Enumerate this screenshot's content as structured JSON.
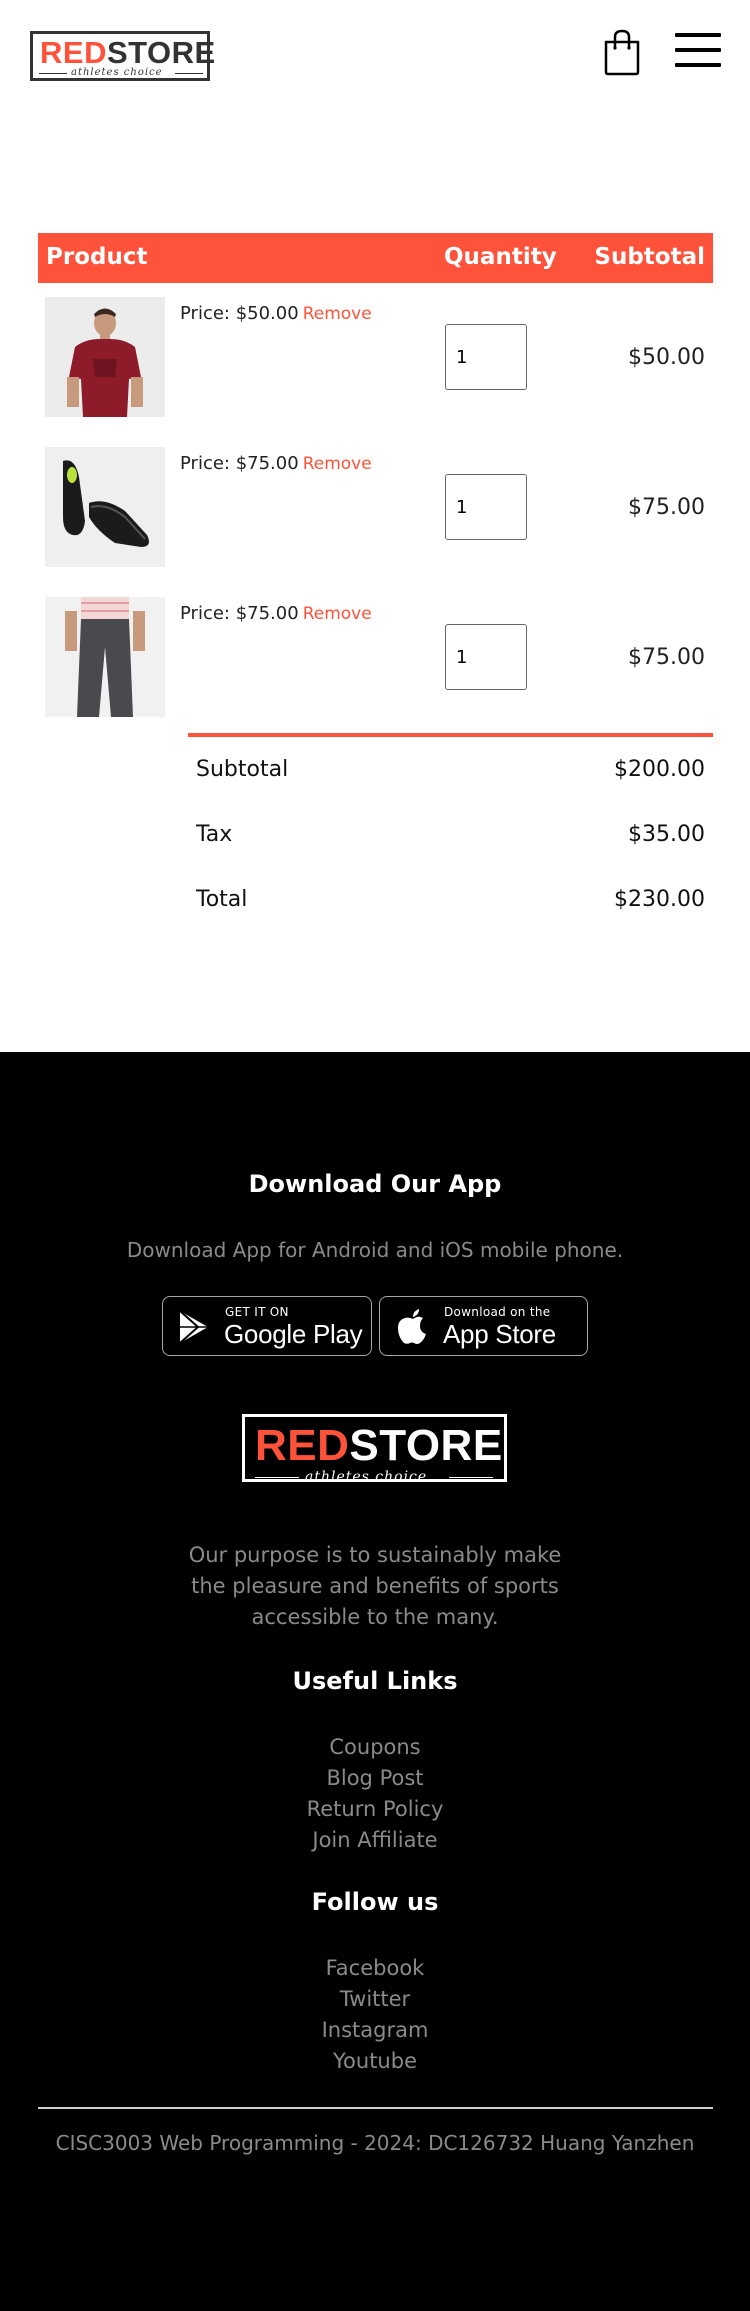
{
  "header": {
    "logo": {
      "red_part": "RED",
      "dark_part": "STORE",
      "tagline": "athletes choice"
    },
    "cart_icon": "shopping-bag-icon",
    "menu_icon": "hamburger-menu-icon"
  },
  "cart": {
    "columns": {
      "product": "Product",
      "quantity": "Quantity",
      "subtotal": "Subtotal"
    },
    "items": [
      {
        "image": "red-tshirt-product-image",
        "price": "Price: $50.00",
        "remove": "Remove",
        "quantity": "1",
        "subtotal": "$50.00"
      },
      {
        "image": "black-shoes-product-image",
        "price": "Price: $75.00",
        "remove": "Remove",
        "quantity": "1",
        "subtotal": "$75.00"
      },
      {
        "image": "grey-joggers-product-image",
        "price": "Price: $75.00",
        "remove": "Remove",
        "quantity": "1",
        "subtotal": "$75.00"
      }
    ],
    "totals": [
      {
        "label": "Subtotal",
        "value": "$200.00"
      },
      {
        "label": "Tax",
        "value": "$35.00"
      },
      {
        "label": "Total",
        "value": "$230.00"
      }
    ]
  },
  "footer": {
    "download_title": "Download Our App",
    "download_text": "Download App for Android and iOS mobile phone.",
    "google_play": {
      "small": "GET IT ON",
      "big": "Google Play",
      "icon": "google-play-icon"
    },
    "app_store": {
      "small": "Download on the",
      "big": "App Store",
      "icon": "apple-icon"
    },
    "logo": {
      "red_part": "RED",
      "white_part": "STORE",
      "tagline": "athletes choice"
    },
    "purpose": "Our purpose is to sustainably make the pleasure and benefits of sports accessible to the many.",
    "useful_links_title": "Useful Links",
    "useful_links": [
      "Coupons",
      "Blog Post",
      "Return Policy",
      "Join Affiliate"
    ],
    "follow_title": "Follow us",
    "follow_links": [
      "Facebook",
      "Twitter",
      "Instagram",
      "Youtube"
    ],
    "copyright": "CISC3003 Web Programming - 2024: DC126732 Huang Yanzhen"
  },
  "colors": {
    "accent": "#ff523b",
    "footer_bg": "#000000",
    "muted_text": "#8a8a8a"
  }
}
